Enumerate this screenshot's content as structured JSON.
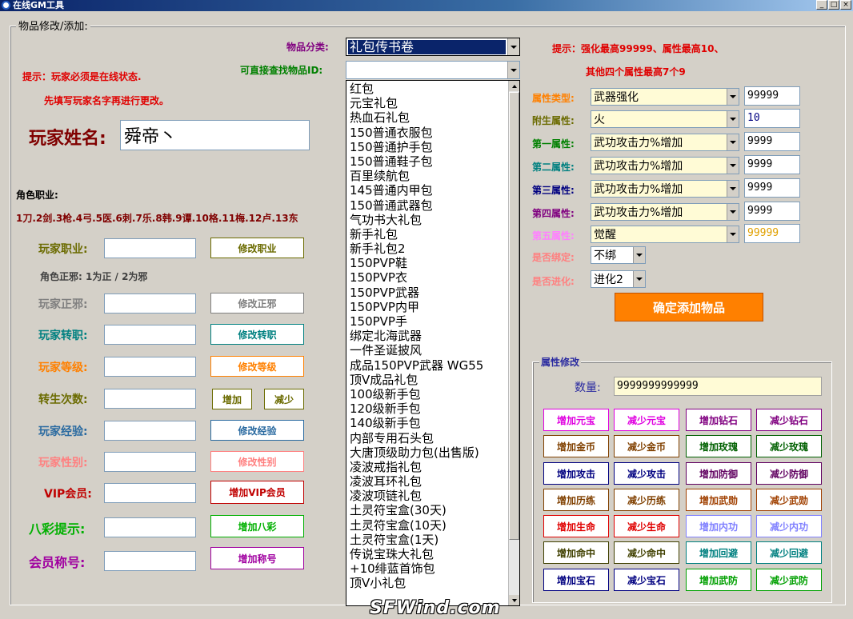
{
  "window": {
    "title": "在线GM工具"
  },
  "group_title": "物品修改/添加:",
  "left": {
    "tip1": "提示：玩家必须是在线状态.",
    "tip2": "先填写玩家名字再进行更改。",
    "player_name_label": "玩家姓名:",
    "player_name_value": "舜帝丶",
    "job_heading": "角色职业:",
    "job_list": "1刀.2剑.3枪.4弓.5医.6刺.7乐.8韩.9谭.10格.11梅.12卢.13东",
    "alignment_hint": "角色正邪: 1为正 / 2为邪",
    "rows": [
      {
        "label": "玩家职业:",
        "button": "修改职业",
        "color": "#6b6b00"
      },
      {
        "label": "玩家正邪:",
        "button": "修改正邪",
        "color": "#808080"
      },
      {
        "label": "玩家转职:",
        "button": "修改转职",
        "color": "#008080"
      },
      {
        "label": "玩家等级:",
        "button": "修改等级",
        "color": "#ff8000"
      },
      {
        "label": "转生次数:",
        "button": "",
        "color": "#6b6b00"
      },
      {
        "label": "玩家经验:",
        "button": "修改经验",
        "color": "#2a6aa0"
      },
      {
        "label": "玩家性别:",
        "button": "修改性别",
        "color": "#ff8080"
      },
      {
        "label": "VIP会员:",
        "button": "增加VIP会员",
        "color": "#c00000"
      },
      {
        "label": "八彩提示:",
        "button": "增加八彩",
        "color": "#00b000"
      },
      {
        "label": "会员称号:",
        "button": "增加称号",
        "color": "#a000a0"
      }
    ],
    "rebirth_add": "增加",
    "rebirth_sub": "减少"
  },
  "middle": {
    "category_label": "物品分类:",
    "category_value": "礼包传书卷",
    "id_label": "可直接查找物品ID:",
    "id_value": "",
    "items": [
      "红包",
      "元宝礼包",
      "热血石礼包",
      "150普通衣服包",
      "150普通护手包",
      "150普通鞋子包",
      "百里续航包",
      "145普通内甲包",
      "150普通武器包",
      "气功书大礼包",
      "新手礼包",
      "新手礼包2",
      "150PVP鞋",
      "150PVP衣",
      "150PVP武器",
      "150PVP内甲",
      "150PVP手",
      "绑定北海武器",
      "一件圣诞披风",
      "成品150PVP武器 WG55",
      "顶V成品礼包",
      "100级新手包",
      "120级新手包",
      "140级新手包",
      "内部专用石头包",
      "大唐顶级助力包(出售版)",
      "凌波戒指礼包",
      "凌波耳环礼包",
      "凌波项链礼包",
      "土灵符宝盒(30天)",
      "土灵符宝盒(10天)",
      "土灵符宝盒(1天)",
      "传说宝珠大礼包",
      "+10绯蓝首饰包",
      "顶V小礼包"
    ]
  },
  "right": {
    "tip_line1": "提示：强化最高99999、属性最高10、",
    "tip_line2": "其他四个属性最高7个9",
    "attrs": [
      {
        "label": "属性类型:",
        "value": "武器强化",
        "input": "99999",
        "color": "#ff8000"
      },
      {
        "label": "附生属性:",
        "value": "火",
        "input": "10",
        "color": "#6b6b00"
      },
      {
        "label": "第一属性:",
        "value": "武功攻击力%增加",
        "input": "9999",
        "color": "#008000"
      },
      {
        "label": "第二属性:",
        "value": "武功攻击力%增加",
        "input": "9999",
        "color": "#008080"
      },
      {
        "label": "第三属性:",
        "value": "武功攻击力%增加",
        "input": "9999",
        "color": "#000080"
      },
      {
        "label": "第四属性:",
        "value": "武功攻击力%增加",
        "input": "9999",
        "color": "#800080"
      },
      {
        "label": "第五属性:",
        "value": "觉醒",
        "input": "99999",
        "color": "#ff80ff"
      }
    ],
    "bind_label": "是否绑定:",
    "bind_value": "不绑",
    "evolve_label": "是否进化:",
    "evolve_value": "进化2",
    "confirm_button": "确定添加物品",
    "attr_mod_title": "属性修改",
    "quantity_label": "数量:",
    "quantity_value": "9999999999999",
    "buttons": [
      [
        {
          "t": "增加元宝",
          "c": "#e000e0"
        },
        {
          "t": "减少元宝",
          "c": "#e000e0"
        },
        {
          "t": "增加钻石",
          "c": "#800080"
        },
        {
          "t": "减少钻石",
          "c": "#800080"
        }
      ],
      [
        {
          "t": "增加金币",
          "c": "#804000"
        },
        {
          "t": "减少金币",
          "c": "#804000"
        },
        {
          "t": "增加玫瑰",
          "c": "#006000"
        },
        {
          "t": "减少玫瑰",
          "c": "#006000"
        }
      ],
      [
        {
          "t": "增加攻击",
          "c": "#000080"
        },
        {
          "t": "减少攻击",
          "c": "#000080"
        },
        {
          "t": "增加防御",
          "c": "#600060"
        },
        {
          "t": "减少防御",
          "c": "#600060"
        }
      ],
      [
        {
          "t": "增加历练",
          "c": "#804000"
        },
        {
          "t": "减少历练",
          "c": "#804000"
        },
        {
          "t": "增加武勋",
          "c": "#a04000"
        },
        {
          "t": "减少武勋",
          "c": "#a04000"
        }
      ],
      [
        {
          "t": "增加生命",
          "c": "#e00000"
        },
        {
          "t": "减少生命",
          "c": "#e00000"
        },
        {
          "t": "增加内功",
          "c": "#8080ff"
        },
        {
          "t": "减少内功",
          "c": "#8080ff"
        }
      ],
      [
        {
          "t": "增加命中",
          "c": "#404000"
        },
        {
          "t": "减少命中",
          "c": "#404000"
        },
        {
          "t": "增加回避",
          "c": "#008080"
        },
        {
          "t": "减少回避",
          "c": "#008080"
        }
      ],
      [
        {
          "t": "增加宝石",
          "c": "#000080"
        },
        {
          "t": "减少宝石",
          "c": "#000080"
        },
        {
          "t": "增加武防",
          "c": "#00a000"
        },
        {
          "t": "减少武防",
          "c": "#00a000"
        }
      ]
    ]
  },
  "watermark": "SFWind.com"
}
